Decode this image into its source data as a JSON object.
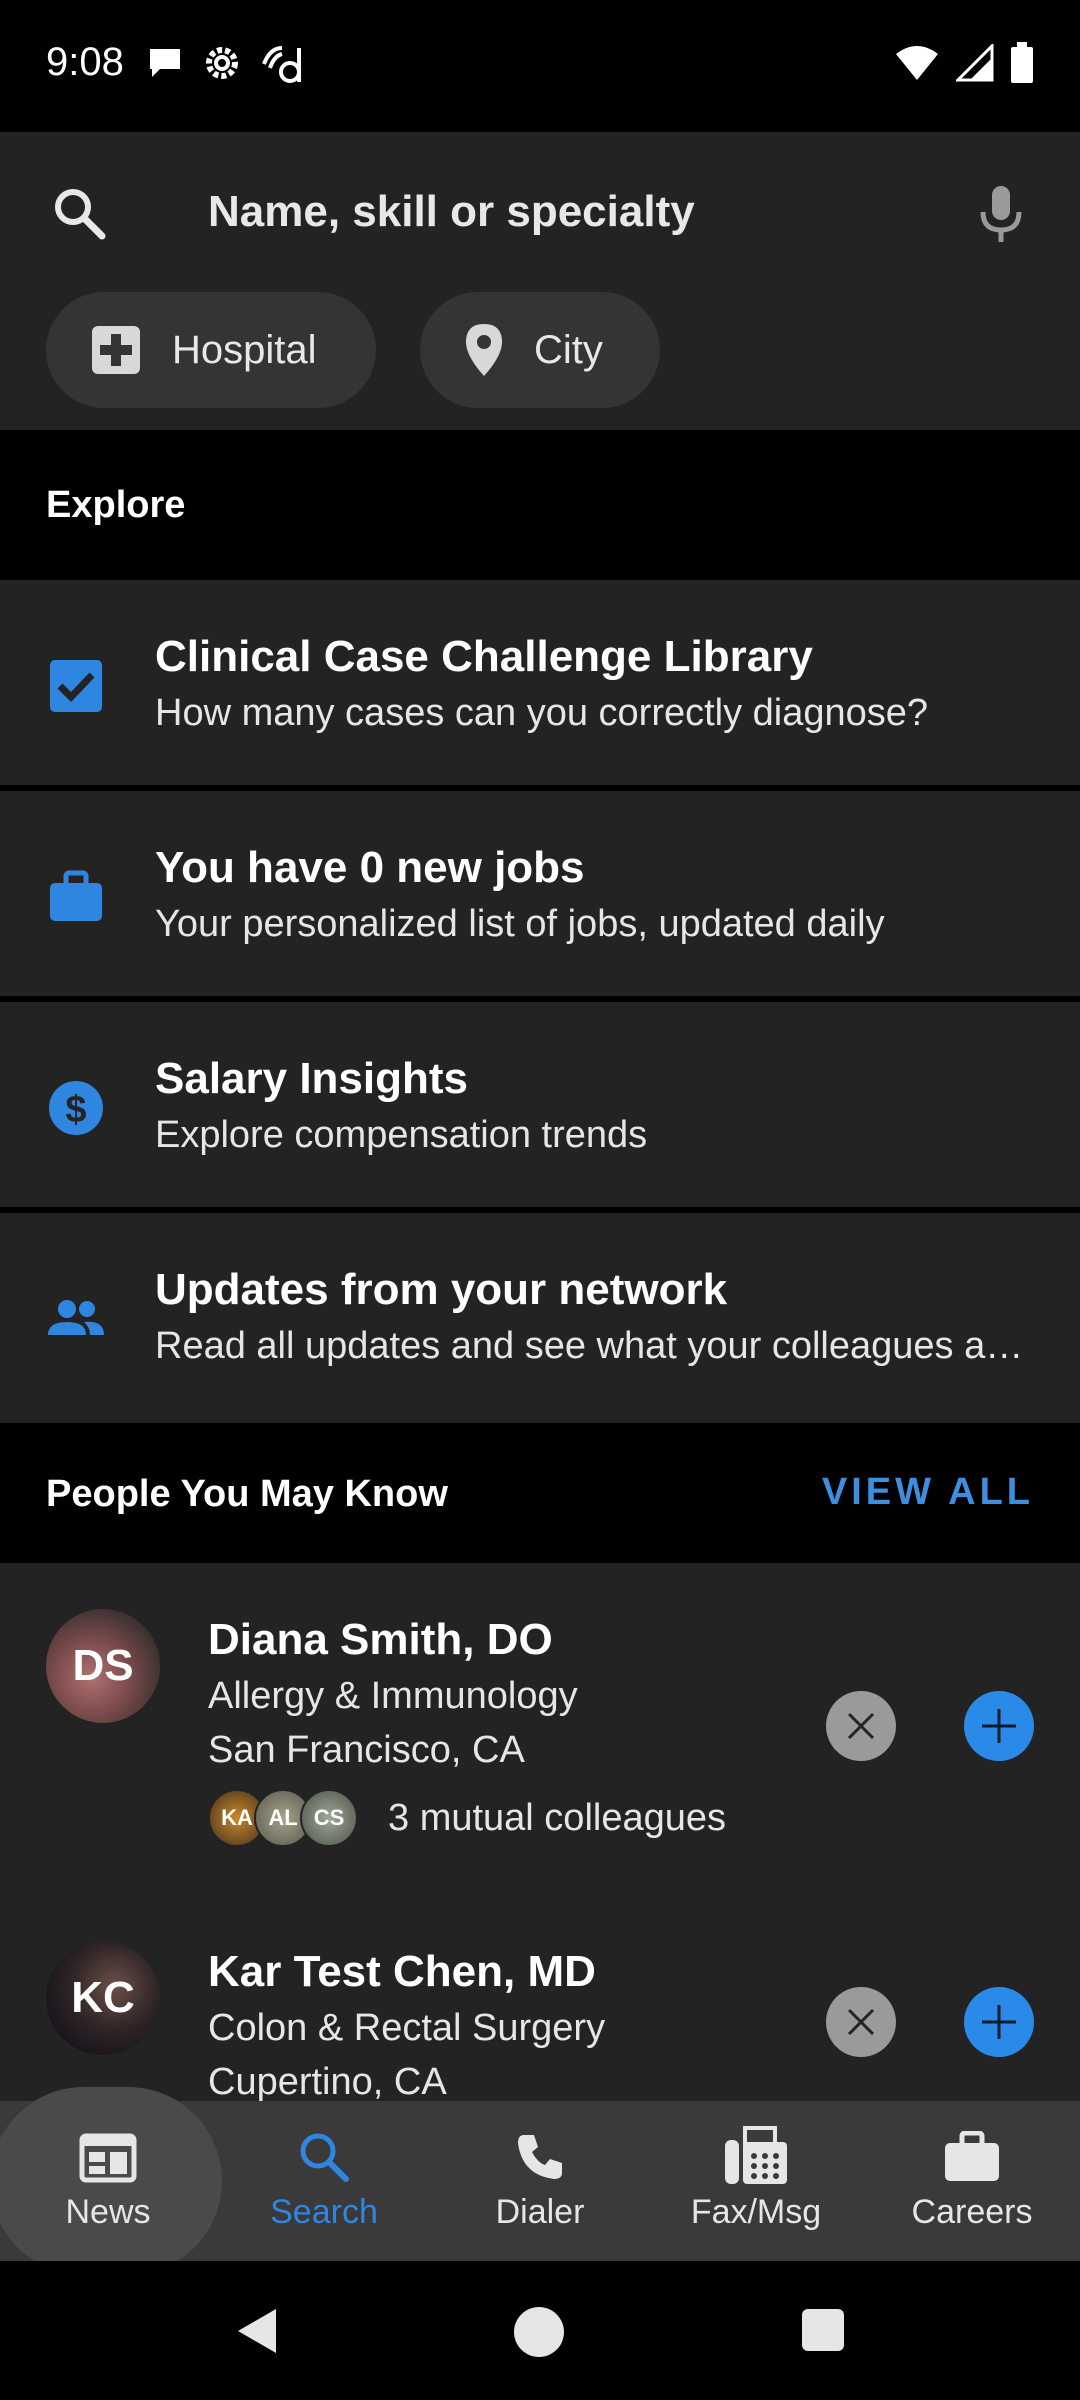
{
  "status_bar": {
    "time": "9:08",
    "left_icons": [
      "chat-bubble-icon",
      "settings-gear-icon",
      "doximity-d-icon"
    ],
    "right_icons": [
      "wifi-icon",
      "cell-signal-icon",
      "battery-icon"
    ]
  },
  "search": {
    "placeholder": "Name, skill or specialty",
    "filters": [
      {
        "label": "Hospital",
        "icon": "hospital-plus-icon"
      },
      {
        "label": "City",
        "icon": "location-pin-icon"
      }
    ]
  },
  "explore": {
    "title": "Explore",
    "items": [
      {
        "title": "Clinical Case Challenge Library",
        "subtitle": "How many cases can you correctly diagnose?",
        "icon": "checkbox-icon"
      },
      {
        "title": "You have 0 new jobs",
        "subtitle": "Your personalized list of jobs, updated daily",
        "icon": "briefcase-icon"
      },
      {
        "title": "Salary Insights",
        "subtitle": "Explore compensation trends",
        "icon": "dollar-icon"
      },
      {
        "title": "Updates from your network",
        "subtitle": "Read all updates and see what your colleagues are saying",
        "icon": "people-icon"
      }
    ]
  },
  "people": {
    "title": "People You May Know",
    "view_all": "VIEW ALL",
    "items": [
      {
        "initials": "DS",
        "name": "Diana Smith, DO",
        "specialty": "Allergy & Immunology",
        "location": "San Francisco, CA",
        "mutual_avatars": [
          "KA",
          "AL",
          "CS"
        ],
        "mutual_text": "3 mutual colleagues"
      },
      {
        "initials": "KC",
        "name": "Kar Test Chen, MD",
        "specialty": "Colon & Rectal Surgery",
        "location": "Cupertino, CA"
      }
    ]
  },
  "bottom_nav": {
    "items": [
      {
        "label": "News",
        "icon": "newspaper-icon"
      },
      {
        "label": "Search",
        "icon": "search-icon",
        "active": true
      },
      {
        "label": "Dialer",
        "icon": "phone-icon"
      },
      {
        "label": "Fax/Msg",
        "icon": "fax-icon"
      },
      {
        "label": "Careers",
        "icon": "briefcase-icon"
      }
    ]
  },
  "colors": {
    "accent": "#2f86e0",
    "background": "#000000",
    "surface": "#232323",
    "nav_bar": "#3a3a3a"
  }
}
